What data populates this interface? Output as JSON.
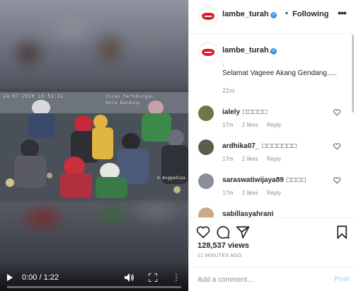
{
  "video": {
    "cctv_timestamp": "24-07-2020 16:51:32",
    "cctv_location_line1": "Dinas Perhubungan",
    "cctv_location_line2": "Kota Bandung",
    "cctv_camera": "A.Anggadipa",
    "time_display": "0:00 / 1:22",
    "progress_fraction": 0
  },
  "header": {
    "username": "lambe_turah",
    "separator": "•",
    "follow_label": "Following",
    "more_label": "•••"
  },
  "caption": {
    "username": "lambe_turah",
    "dot": ".",
    "line1": ".",
    "text": "Selamat Vageee Akang Gendang.....",
    "time": "21m"
  },
  "comments": [
    {
      "username": "ialely",
      "text": "□□□□□",
      "time": "17m",
      "likes": "2 likes",
      "reply": "Reply",
      "avatar_color": "#6b7a45"
    },
    {
      "username": "ardhika07_",
      "text": "□□□□□□□",
      "time": "17m",
      "likes": "2 likes",
      "reply": "Reply",
      "avatar_color": "#5a5f4a"
    },
    {
      "username": "saraswatiwijaya89",
      "text": "□□□□",
      "time": "17m",
      "likes": "2 likes",
      "reply": "Reply",
      "avatar_color": "#8a8f99"
    },
    {
      "username": "sabillasyahrani",
      "text": "",
      "time": "",
      "likes": "",
      "reply": "",
      "avatar_color": "#c9a98a"
    }
  ],
  "actions": {
    "likes_count": "128,537 views",
    "posted_time": "21 MINUTES AGO",
    "icons": [
      "heart-icon",
      "comment-icon",
      "share-icon",
      "bookmark-icon"
    ]
  },
  "add_comment": {
    "placeholder": "Add a comment…",
    "post_label": "Post"
  },
  "colors": {
    "verified": "#3897f0",
    "post_disabled": "#b2dffc",
    "text": "#262626",
    "muted": "#8e8e8e"
  }
}
